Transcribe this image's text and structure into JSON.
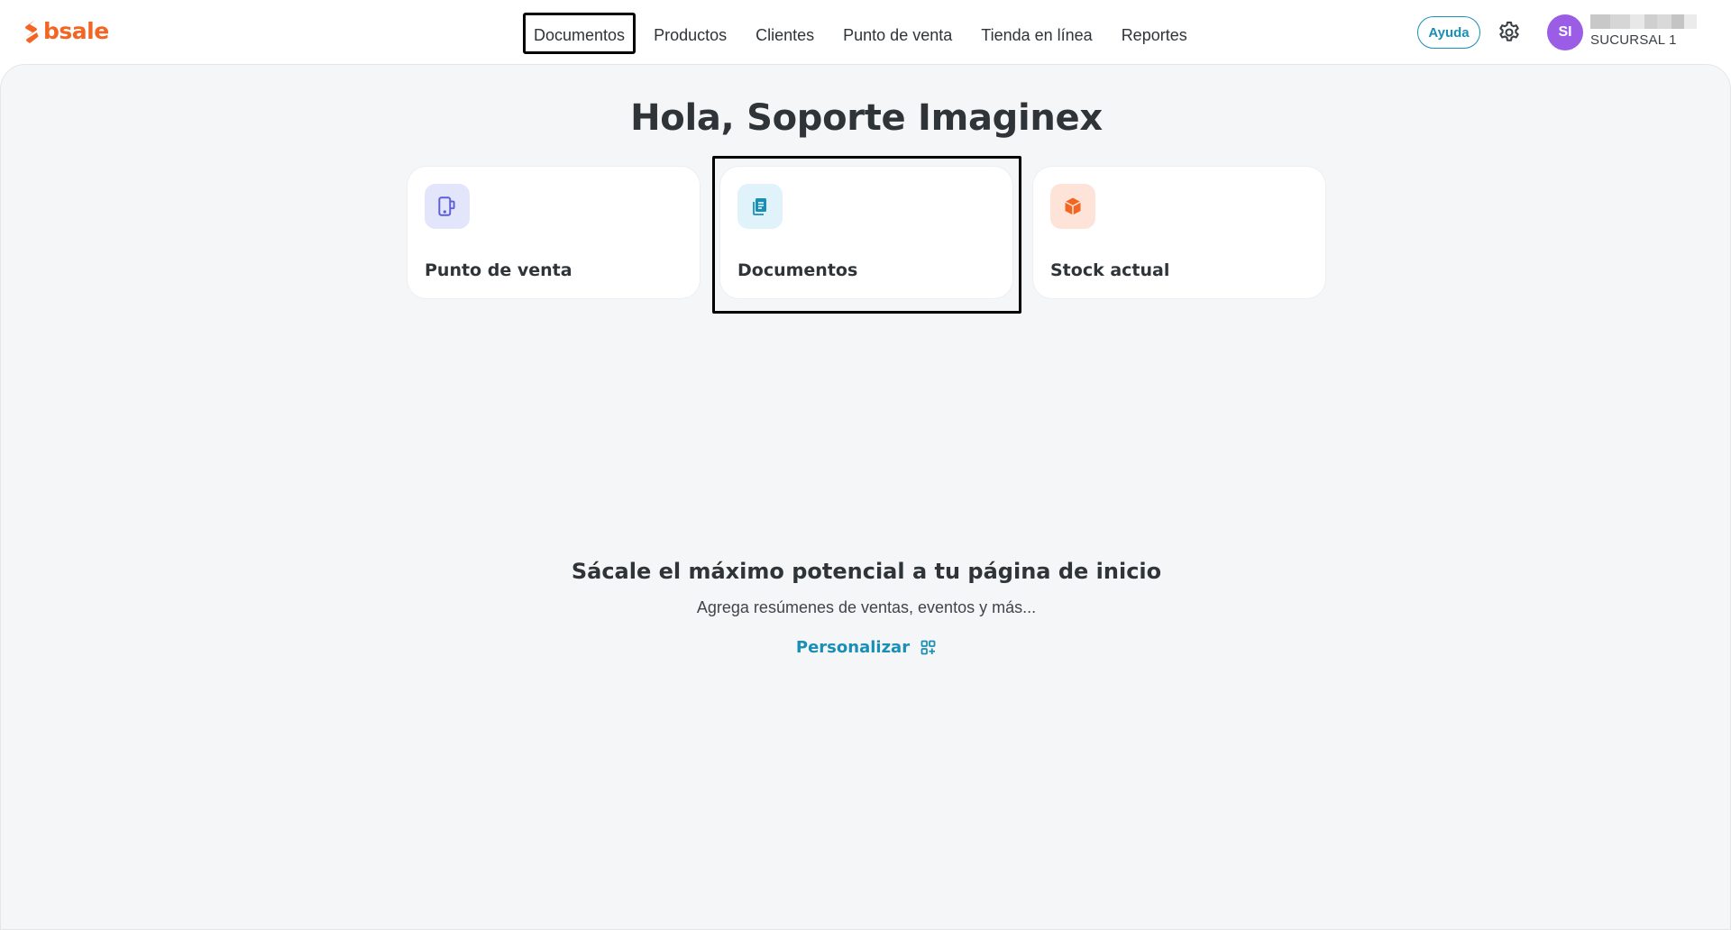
{
  "header": {
    "logo_text": "bsale",
    "nav_items": [
      {
        "label": "Documentos",
        "focused": true
      },
      {
        "label": "Productos"
      },
      {
        "label": "Clientes"
      },
      {
        "label": "Punto de venta"
      },
      {
        "label": "Tienda en línea"
      },
      {
        "label": "Reportes"
      }
    ],
    "help_label": "Ayuda",
    "settings_icon": "gear-icon",
    "user": {
      "initials": "SI",
      "name_redacted": true,
      "branch": "SUCURSAL 1"
    }
  },
  "main": {
    "greeting": "Hola, Soporte Imaginex",
    "cards": [
      {
        "label": "Punto de venta",
        "icon": "pos-device-icon",
        "icon_bg": "#e3e5fb",
        "icon_color": "#5b5fd6"
      },
      {
        "label": "Documentos",
        "icon": "document-icon",
        "icon_bg": "#e0f2fa",
        "icon_color": "#1a8fb6",
        "focused": true
      },
      {
        "label": "Stock actual",
        "icon": "box-icon",
        "icon_bg": "#fde3d8",
        "icon_color": "#f26522"
      }
    ],
    "promo": {
      "title": "Sácale el máximo potencial a tu página de inicio",
      "subtitle": "Agrega resúmenes de ventas, eventos y más...",
      "link_label": "Personalizar",
      "link_icon": "widget-add-icon"
    }
  },
  "colors": {
    "brand": "#f26522",
    "accent": "#1a8fb6",
    "avatar": "#9b5de5",
    "page_bg": "#f5f6f7"
  }
}
